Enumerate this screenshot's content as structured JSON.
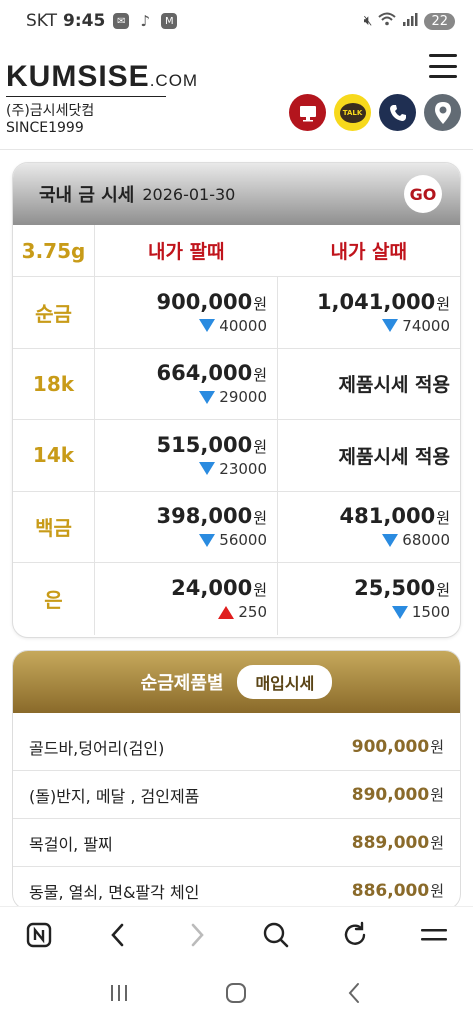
{
  "status": {
    "carrier": "SKT",
    "time": "9:45",
    "icons": [
      "talk-icon",
      "tiktok-icon",
      "m-icon"
    ],
    "battery": "22"
  },
  "header": {
    "logo_main": "KUMSISE",
    "logo_domain": ".COM",
    "logo_sub": "(주)금시세닷컴 SINCE1999",
    "icons": [
      "pc-icon",
      "kakao-talk-icon",
      "phone-icon",
      "location-icon"
    ],
    "talk_label": "TALK"
  },
  "price_card": {
    "title": "국내 금 시세",
    "date": "2026-01-30",
    "go_label": "GO",
    "unit_label": "3.75g",
    "sell_header": "내가 팔때",
    "buy_header": "내가 살때",
    "won": "원",
    "rows": [
      {
        "kind": "순금",
        "sell": "900,000",
        "sell_dir": "down",
        "sell_chg": "40000",
        "buy": "1,041,000",
        "buy_dir": "down",
        "buy_chg": "74000",
        "buy_text": ""
      },
      {
        "kind": "18k",
        "sell": "664,000",
        "sell_dir": "down",
        "sell_chg": "29000",
        "buy": "",
        "buy_dir": "",
        "buy_chg": "",
        "buy_text": "제품시세 적용"
      },
      {
        "kind": "14k",
        "sell": "515,000",
        "sell_dir": "down",
        "sell_chg": "23000",
        "buy": "",
        "buy_dir": "",
        "buy_chg": "",
        "buy_text": "제품시세 적용"
      },
      {
        "kind": "백금",
        "sell": "398,000",
        "sell_dir": "down",
        "sell_chg": "56000",
        "buy": "481,000",
        "buy_dir": "down",
        "buy_chg": "68000",
        "buy_text": ""
      },
      {
        "kind": "은",
        "sell": "24,000",
        "sell_dir": "up",
        "sell_chg": "250",
        "buy": "25,500",
        "buy_dir": "down",
        "buy_chg": "1500",
        "buy_text": ""
      }
    ]
  },
  "product_card": {
    "title": "순금제품별",
    "pill": "매입시세",
    "items": [
      {
        "name": "골드바,덩어리(검인)",
        "price": "900,000"
      },
      {
        "name": "(돌)반지, 메달 , 검인제품",
        "price": "890,000"
      },
      {
        "name": "목걸이, 팔찌",
        "price": "889,000"
      },
      {
        "name": "동물, 열쇠, 면&팔각 체인",
        "price": "886,000"
      }
    ]
  },
  "browser_nav": [
    "tabs-icon",
    "back-icon",
    "forward-icon",
    "search-icon",
    "refresh-icon",
    "menu-icon"
  ],
  "system_nav": [
    "recents-icon",
    "home-icon",
    "back-icon"
  ],
  "colors": {
    "gold": "#c89b18",
    "red": "#c0141c",
    "down": "#2a8be0",
    "up": "#e01e1e",
    "bronze": "#8a6a2a"
  }
}
